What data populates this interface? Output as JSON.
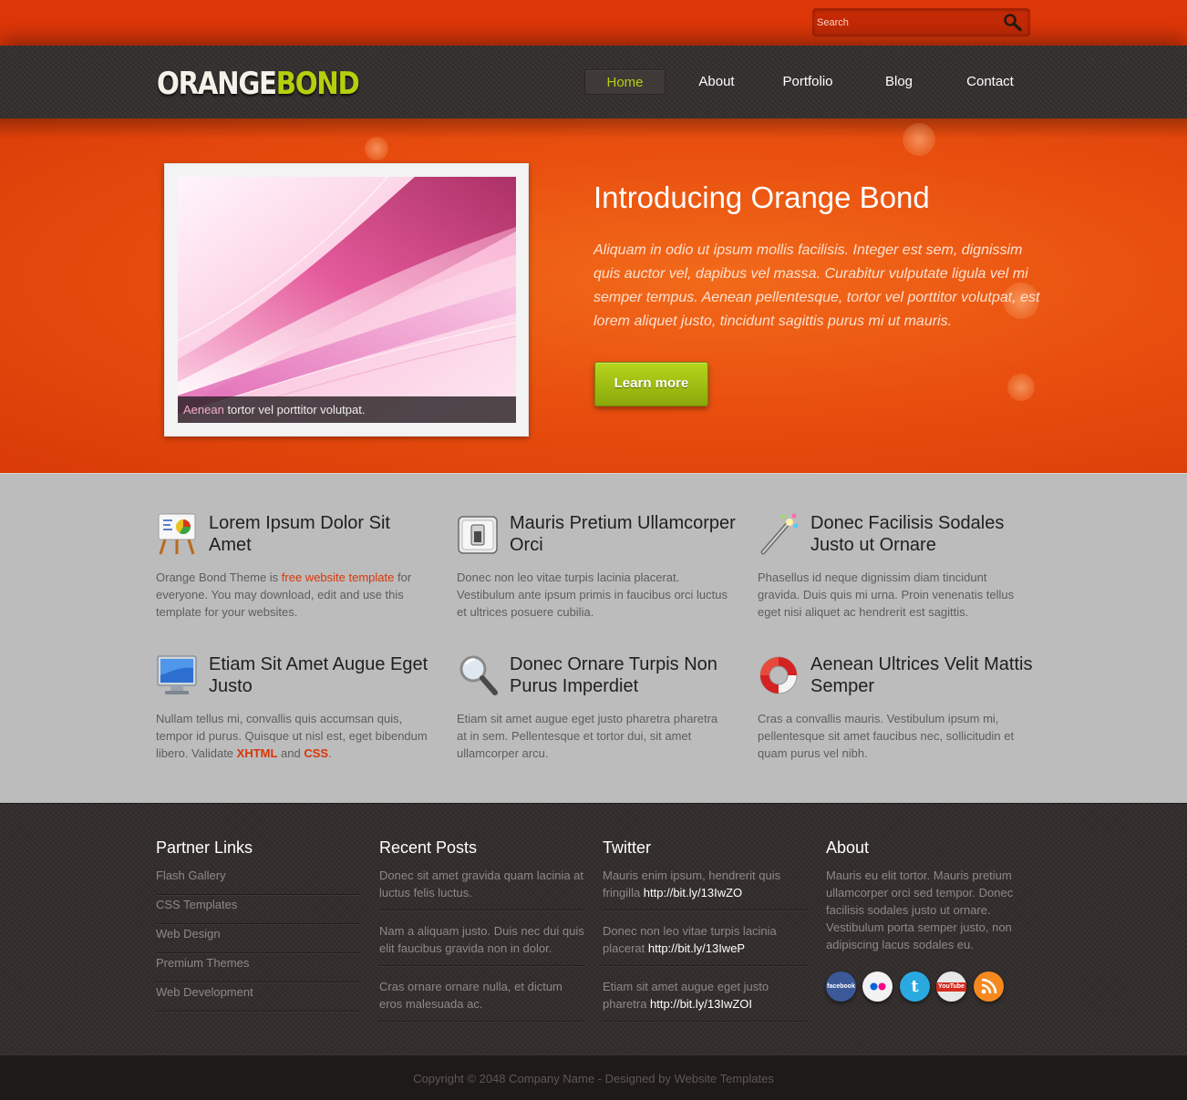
{
  "search": {
    "placeholder": "Search"
  },
  "logo": {
    "part1": "ORANGE",
    "part2": "BOND"
  },
  "nav": [
    "Home",
    "About",
    "Portfolio",
    "Blog",
    "Contact"
  ],
  "hero": {
    "caption_highlight": "Aenean",
    "caption_rest": " tortor vel porttitor volutpat.",
    "title": "Introducing Orange Bond",
    "text": "Aliquam in odio ut ipsum mollis facilisis. Integer est sem, dignissim quis auctor vel, dapibus vel massa. Curabitur vulputate ligula vel mi semper tempus. Aenean pellentesque, tortor vel porttitor volutpat, est lorem aliquet justo, tincidunt sagittis purus mi ut mauris.",
    "button": "Learn more"
  },
  "features": [
    {
      "icon": "presentation-chart-icon",
      "title": "Lorem Ipsum Dolor Sit Amet",
      "text_before": "Orange Bond Theme is ",
      "link": "free website template",
      "text_after": " for everyone. You may download, edit and use this template for your websites."
    },
    {
      "icon": "light-switch-icon",
      "title": "Mauris Pretium Ullamcorper Orci",
      "text": "Donec non leo vitae turpis lacinia placerat. Vestibulum ante ipsum primis in faucibus orci luctus et ultrices posuere cubilia."
    },
    {
      "icon": "magic-wand-icon",
      "title": "Donec Facilisis Sodales Justo ut Ornare",
      "text": "Phasellus id neque dignissim diam tincidunt gravida. Duis quis mi urna. Proin venenatis tellus eget nisi aliquet ac hendrerit est sagittis."
    },
    {
      "icon": "monitor-icon",
      "title": "Etiam Sit Amet Augue Eget Justo",
      "text_before": "Nullam tellus mi, convallis quis accumsan quis, tempor id purus. Quisque ut nisl est, eget bibendum libero. Validate ",
      "link1": "XHTML",
      "mid": " and ",
      "link2": "CSS",
      "end": "."
    },
    {
      "icon": "magnifier-icon",
      "title": "Donec Ornare Turpis Non Purus Imperdiet",
      "text": "Etiam sit amet augue eget justo pharetra pharetra at in sem. Pellentesque et tortor dui, sit amet ullamcorper arcu."
    },
    {
      "icon": "lifebuoy-icon",
      "title": "Aenean Ultrices Velit Mattis Semper",
      "text": "Cras a convallis mauris. Vestibulum ipsum mi, pellentesque sit amet faucibus nec, sollicitudin et quam purus vel nibh."
    }
  ],
  "footer": {
    "partner": {
      "title": "Partner Links",
      "items": [
        "Flash Gallery",
        "CSS Templates",
        "Web Design",
        "Premium Themes",
        "Web Development"
      ]
    },
    "posts": {
      "title": "Recent Posts",
      "items": [
        "Donec sit amet gravida quam lacinia at luctus felis luctus.",
        "Nam a aliquam justo. Duis nec dui quis elit faucibus gravida non in dolor.",
        "Cras ornare ornare nulla, et dictum eros malesuada ac."
      ]
    },
    "twitter": {
      "title": "Twitter",
      "items": [
        {
          "text": "Mauris enim ipsum, hendrerit quis fringilla ",
          "url": "http://bit.ly/13IwZO"
        },
        {
          "text": "Donec non leo vitae turpis lacinia placerat ",
          "url": "http://bit.ly/13IweP"
        },
        {
          "text": "Etiam sit amet augue eget justo pharetra ",
          "url": "http://bit.ly/13IwZOI"
        }
      ]
    },
    "about": {
      "title": "About",
      "text": "Mauris eu elit tortor. Mauris pretium ullamcorper orci sed tempor. Donec facilisis sodales justo ut ornare. Vestibulum porta semper justo, non adipiscing lacus sodales eu."
    },
    "socials": [
      {
        "icon": "facebook-icon",
        "label": "facebook",
        "color": "#3b5998"
      },
      {
        "icon": "flickr-icon",
        "color": "#f2f2f2"
      },
      {
        "icon": "twitter-icon",
        "color": "#2aa9e0"
      },
      {
        "icon": "youtube-icon",
        "label": "YouTube",
        "color": "#e8e8e8"
      },
      {
        "icon": "rss-icon",
        "color": "#f5891f"
      }
    ]
  },
  "copyright": "Copyright © 2048 Company Name - Designed by Website Templates"
}
